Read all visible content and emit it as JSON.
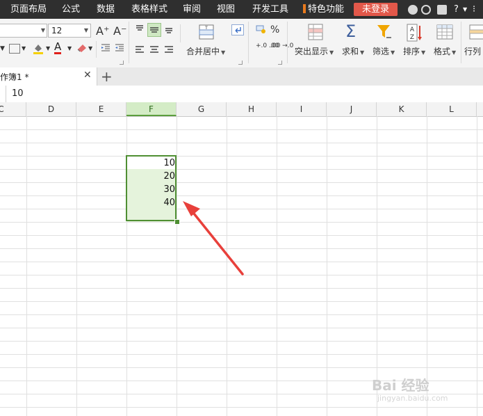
{
  "menu": {
    "items": [
      "页面布局",
      "公式",
      "数据",
      "表格样式",
      "审阅",
      "视图",
      "开发工具"
    ],
    "special": "特色功能",
    "login": "未登录",
    "help_symbol": "?"
  },
  "ribbon": {
    "font_size": "12",
    "grow_font_icon": "A⁺",
    "shrink_font_icon": "A⁻",
    "font_color_letter": "A",
    "merge_center": "合并居中",
    "percent": "%",
    "inc_decimal": "+.0 .00",
    "dec_decimal": ".00 →.0",
    "highlight": "突出显示",
    "sum": "求和",
    "sum_symbol": "Σ",
    "filter": "筛选",
    "sort": "排序",
    "sort_symbol": "A Z",
    "format": "格式",
    "rowcol": "行列"
  },
  "tabs": {
    "doc_name": "作簿1 *",
    "close_symbol": "✕",
    "add_symbol": "+"
  },
  "formula": {
    "value": "10"
  },
  "columns": [
    "C",
    "D",
    "E",
    "F",
    "G",
    "H",
    "I",
    "J",
    "K",
    "L"
  ],
  "active_column": "F",
  "cells": [
    {
      "column": "F",
      "row_index": 3,
      "value": "10"
    },
    {
      "column": "F",
      "row_index": 4,
      "value": "20"
    },
    {
      "column": "F",
      "row_index": 5,
      "value": "30"
    },
    {
      "column": "F",
      "row_index": 6,
      "value": "40"
    }
  ],
  "annotation": {
    "color": "#e8403b",
    "icon": "red-arrow-icon"
  },
  "watermark": {
    "brand": "Bai 经验",
    "url": "jingyan.baidu.com"
  },
  "colors": {
    "selection_border": "#4f8f33",
    "selection_fill": "#e5f3dc",
    "login_button": "#e2584a",
    "menubar": "#2f2f2f"
  }
}
